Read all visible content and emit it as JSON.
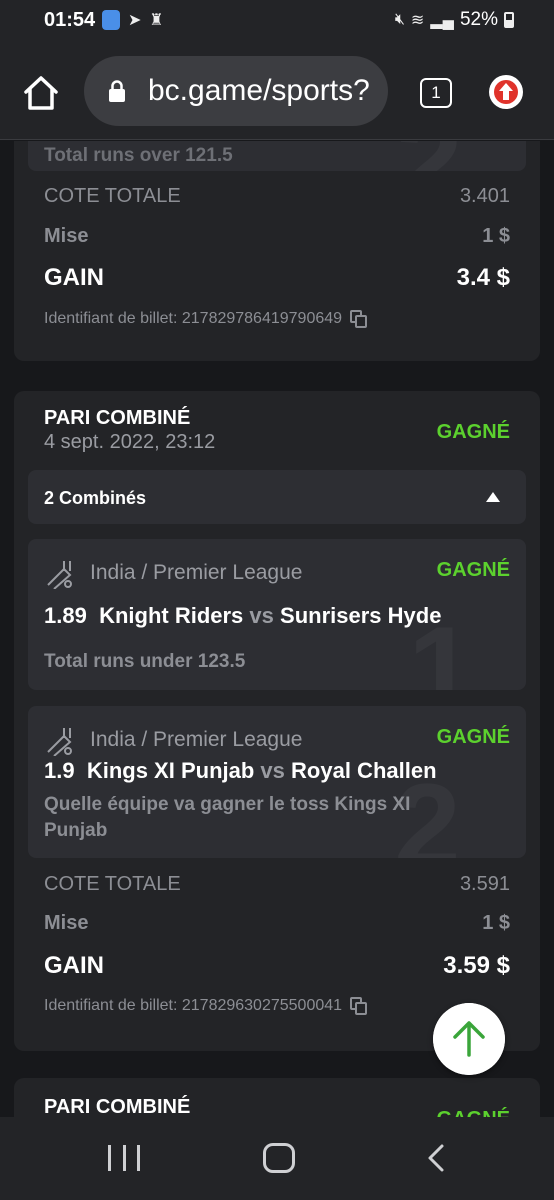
{
  "status_bar": {
    "time": "01:54",
    "battery": "52%",
    "icons": [
      "shield-icon",
      "telegram-icon",
      "game-icon",
      "mute-icon",
      "wifi-icon",
      "signal-icon",
      "battery-icon"
    ]
  },
  "browser": {
    "url": "bc.game/sports?",
    "tab_count": "1"
  },
  "card1": {
    "partial_market": "Total runs over 121.5",
    "bg_number": "2",
    "total_odds_label": "COTE TOTALE",
    "total_odds": "3.401",
    "stake_label": "Mise",
    "stake": "1 $",
    "gain_label": "GAIN",
    "gain": "3.4 $",
    "ticket_label": "Identifiant de billet: 217829786419790649"
  },
  "card2": {
    "title": "PARI COMBINÉ",
    "date": "4 sept. 2022, 23:12",
    "status": "GAGNÉ",
    "combos_label": "2 Combinés",
    "legs": [
      {
        "league": "India / Premier League",
        "status": "GAGNÉ",
        "odds": "1.89",
        "home": "Knight Riders",
        "vs": "vs",
        "away": "Sunrisers Hyde",
        "market": "Total runs under 123.5",
        "bg_number": "1"
      },
      {
        "league": "India / Premier League",
        "status": "GAGNÉ",
        "odds": "1.9",
        "home": "Kings XI Punjab",
        "vs": "vs",
        "away": "Royal Challen",
        "market_line1": "Quelle équipe va gagner le toss Kings XI",
        "market_line2": "Punjab",
        "bg_number": "2"
      }
    ],
    "total_odds_label": "COTE TOTALE",
    "total_odds": "3.591",
    "stake_label": "Mise",
    "stake": "1 $",
    "gain_label": "GAIN",
    "gain": "3.59 $",
    "ticket_label": "Identifiant de billet: 217829630275500041"
  },
  "card3": {
    "title": "PARI COMBINÉ",
    "status": "GAGNÉ"
  },
  "colors": {
    "background": "#17181b",
    "card": "#232427",
    "sub_card": "#2d2e33",
    "win_green": "#5cd12e",
    "muted_text": "#8c8e94"
  }
}
